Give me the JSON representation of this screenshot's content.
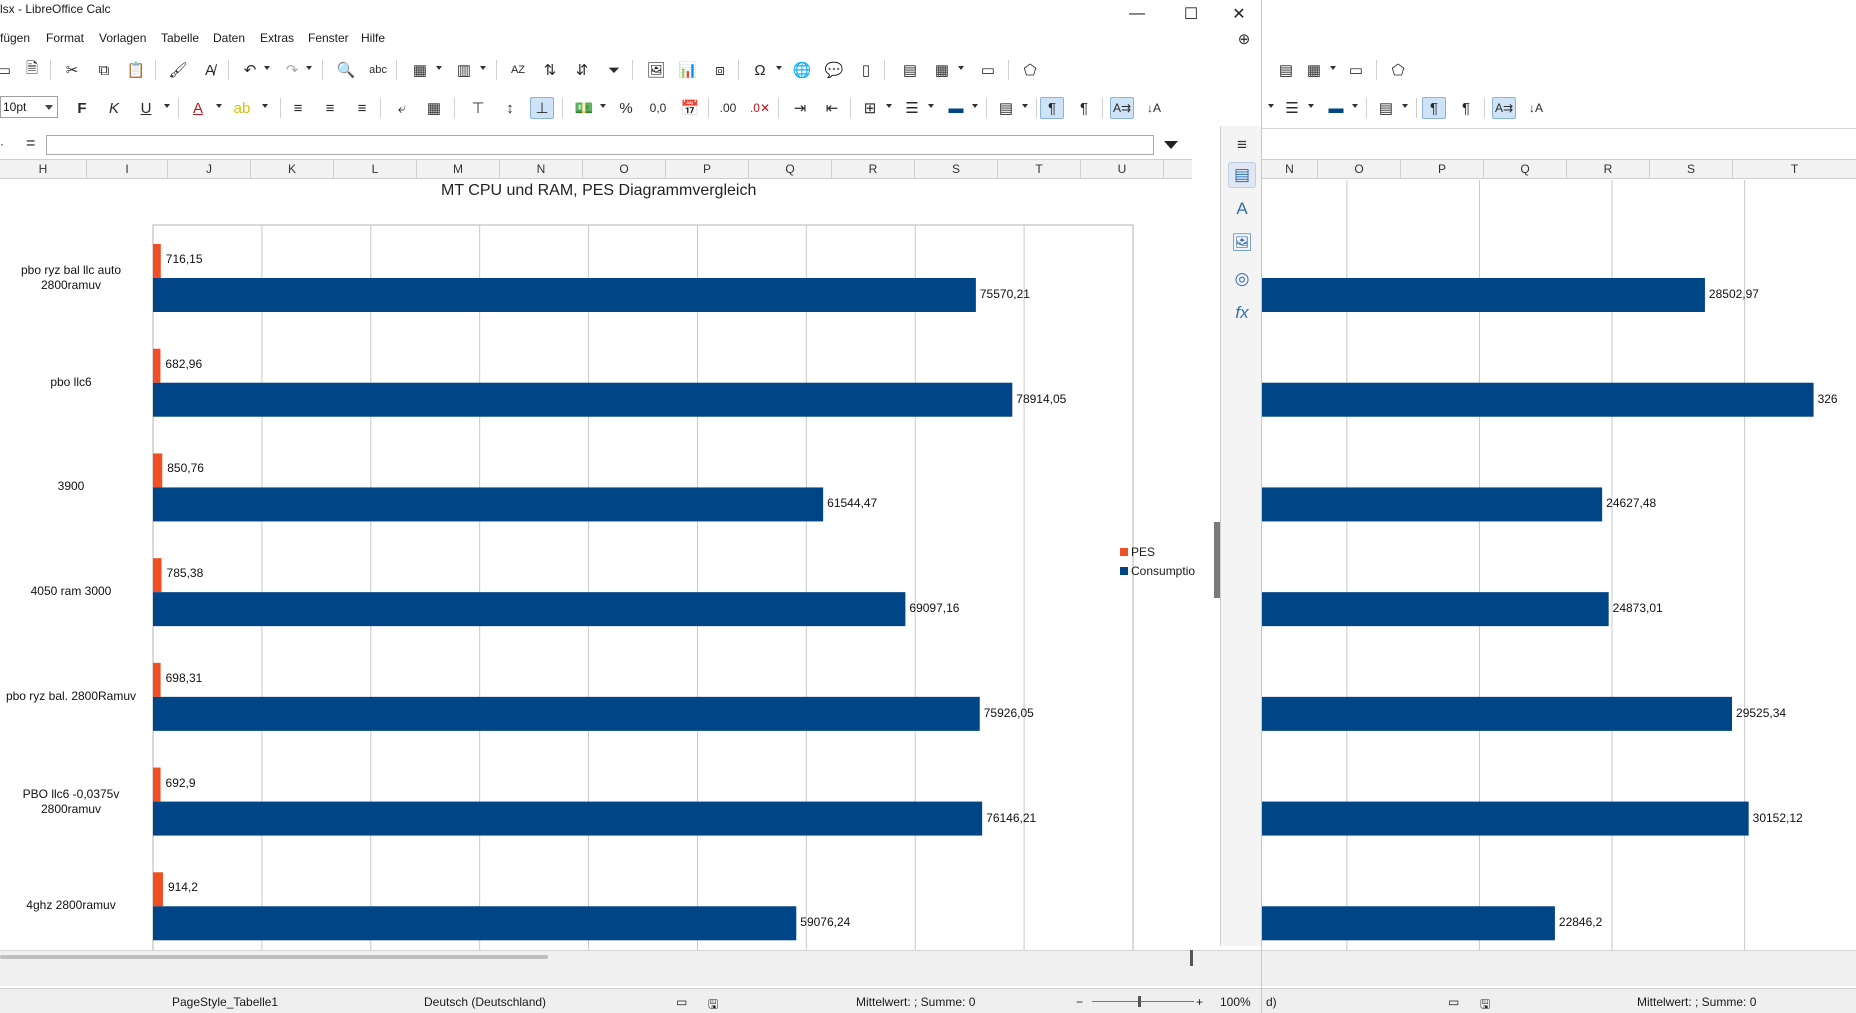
{
  "left_window": {
    "title": "lsx - LibreOffice Calc",
    "window_controls": {
      "minimize": "—",
      "maximize": "☐",
      "close": "✕"
    },
    "menu": [
      "fügen",
      "Format",
      "Vorlagen",
      "Tabelle",
      "Daten",
      "Extras",
      "Fenster",
      "Hilfe"
    ],
    "font_size": "10pt",
    "formula_bar_symbol": "=",
    "columns": [
      "H",
      "I",
      "J",
      "K",
      "L",
      "M",
      "N",
      "O",
      "P",
      "Q",
      "R",
      "S",
      "T",
      "U"
    ],
    "status": {
      "page_style": "PageStyle_Tabelle1",
      "language": "Deutsch (Deutschland)",
      "summary": "Mittelwert: ; Summe: 0",
      "zoom": "100%"
    }
  },
  "right_window": {
    "columns": [
      "N",
      "O",
      "P",
      "Q",
      "R",
      "S",
      "T"
    ],
    "status": {
      "language_fragment": "d)",
      "summary": "Mittelwert: ; Summe: 0"
    }
  },
  "colors": {
    "pes": "#f04e23",
    "consumption": "#004586",
    "grid": "#c8c8c8",
    "toolbar_active": "#cfe3f7"
  },
  "chart_data": [
    {
      "type": "bar",
      "orientation": "horizontal",
      "title": "MT CPU und RAM, PES Diagrammvergleich",
      "categories": [
        "pbo ryz bal llc auto 2800ramuv",
        "pbo llc6",
        "3900",
        "4050 ram 3000",
        "pbo ryz bal. 2800Ramuv",
        "PBO llc6 -0,0375v 2800ramuv",
        "4ghz 2800ramuv"
      ],
      "category_lines": [
        [
          "pbo ryz bal llc auto",
          "2800ramuv"
        ],
        [
          "pbo llc6"
        ],
        [
          "3900"
        ],
        [
          "4050 ram 3000"
        ],
        [
          "pbo ryz bal. 2800Ramuv"
        ],
        [
          "PBO llc6 -0,0375v",
          "2800ramuv"
        ],
        [
          "4ghz 2800ramuv"
        ]
      ],
      "series": [
        {
          "name": "PES",
          "values": [
            716.15,
            682.96,
            850.76,
            785.38,
            698.31,
            692.9,
            914.2
          ],
          "labels": [
            "716,15",
            "682,96",
            "850,76",
            "785,38",
            "698,31",
            "692,9",
            "914,2"
          ]
        },
        {
          "name": "Consumptio",
          "values": [
            75570.21,
            78914.05,
            61544.47,
            69097.16,
            75926.05,
            76146.21,
            59076.24
          ],
          "labels": [
            "75570,21",
            "78914,05",
            "61544,47",
            "69097,16",
            "75926,05",
            "76146,21",
            "59076,24"
          ]
        }
      ],
      "xlim": [
        0,
        90000
      ],
      "grid": true,
      "legend": "right"
    },
    {
      "type": "bar",
      "orientation": "horizontal",
      "series": [
        {
          "values": [
            28502.97,
            32600,
            24627.48,
            24873.01,
            29525.34,
            30152.12,
            22846.2
          ],
          "labels": [
            "28502,97",
            "326",
            "24627,48",
            "24873,01",
            "29525,34",
            "30152,12",
            "22846,2"
          ]
        }
      ],
      "xticks": [
        "15000",
        "20000",
        "25000",
        "30000"
      ],
      "xlim_visible": [
        11800,
        34200
      ],
      "grid": true
    }
  ]
}
